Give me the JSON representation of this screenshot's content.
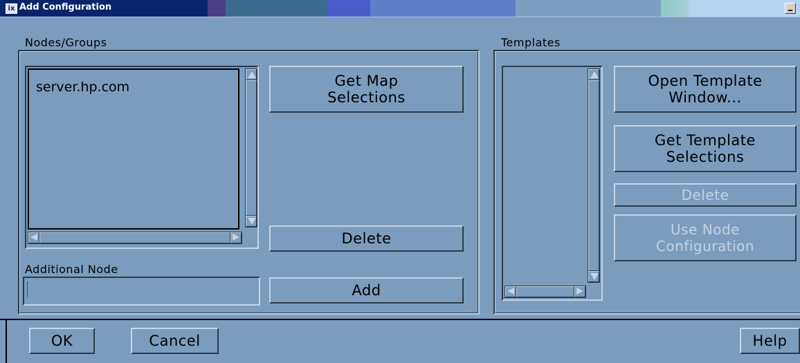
{
  "window": {
    "title": "Add Configuration",
    "icon": "app-x-icon"
  },
  "nodes_groups": {
    "label": "Nodes/Groups",
    "items": [
      "server.hp.com"
    ],
    "get_map_selections": "Get Map\nSelections",
    "delete": "Delete",
    "additional_node_label": "Additional Node",
    "additional_node_value": "",
    "add": "Add"
  },
  "templates": {
    "label": "Templates",
    "items": [],
    "open_template_window": "Open Template\nWindow...",
    "get_template_selections": "Get Template\nSelections",
    "delete": "Delete",
    "use_node_configuration": "Use Node\nConfiguration"
  },
  "footer": {
    "ok": "OK",
    "cancel": "Cancel",
    "help": "Help"
  }
}
